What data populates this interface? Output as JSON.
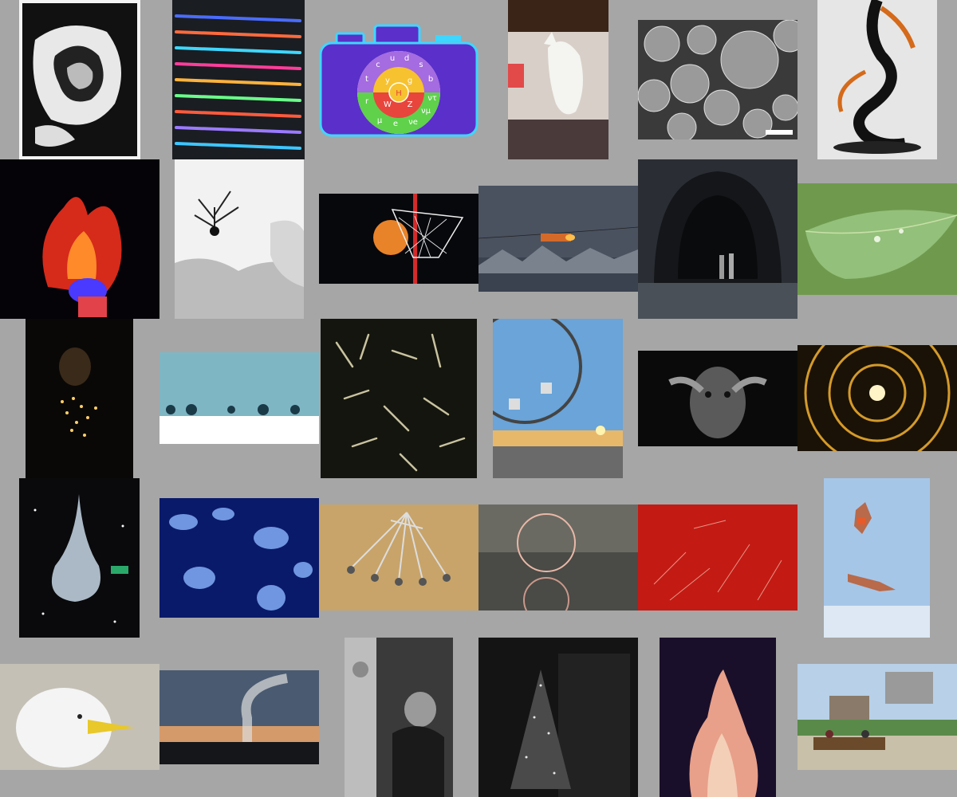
{
  "gallery": {
    "tiles": [
      {
        "label": "Abstract black and white swirl"
      },
      {
        "label": "Colorful light streaks"
      },
      {
        "label": "Camera logo with Greek letters"
      },
      {
        "label": "White cat statue in living room"
      },
      {
        "label": "Microscope spheres"
      },
      {
        "label": "Ink in water"
      },
      {
        "label": "Flame with red and blue"
      },
      {
        "label": "Bare tree in snowy landscape"
      },
      {
        "label": "Basketball entering net"
      },
      {
        "label": "Santa sleigh over mountains"
      },
      {
        "label": "Tunnel with two people"
      },
      {
        "label": "Green leaf with droplets"
      },
      {
        "label": "Person holding fairy lights"
      },
      {
        "label": "Bubbles on water surface"
      },
      {
        "label": "Scattered matchsticks"
      },
      {
        "label": "Ferris wheel at sunset"
      },
      {
        "label": "Painted face with hands"
      },
      {
        "label": "Golden light tunnel"
      },
      {
        "label": "Water balloon bursting"
      },
      {
        "label": "Blue jellyfish"
      },
      {
        "label": "Fencing swords on floor"
      },
      {
        "label": "Soap bubble close-up"
      },
      {
        "label": "Red frost pattern"
      },
      {
        "label": "Two cliff divers"
      },
      {
        "label": "Seagull head"
      },
      {
        "label": "Smokestack at dusk"
      },
      {
        "label": "Old man in chair"
      },
      {
        "label": "Christmas tree at night"
      },
      {
        "label": "Bonfire"
      },
      {
        "label": "Atomic bomb dome with bench"
      }
    ]
  },
  "logo": {
    "letters": [
      "c",
      "u",
      "d",
      "s",
      "b",
      "t",
      "y",
      "g",
      "r",
      "H",
      "W",
      "Z",
      "μ",
      "e",
      "νe",
      "νμ",
      "ντ"
    ],
    "colors": {
      "camera_body": "#5b2fc9",
      "camera_border": "#3fd6ff",
      "wheel_purple": "#a56be0",
      "wheel_green": "#5fd14b",
      "wheel_red": "#e8453c",
      "wheel_yellow": "#f6c230"
    }
  }
}
